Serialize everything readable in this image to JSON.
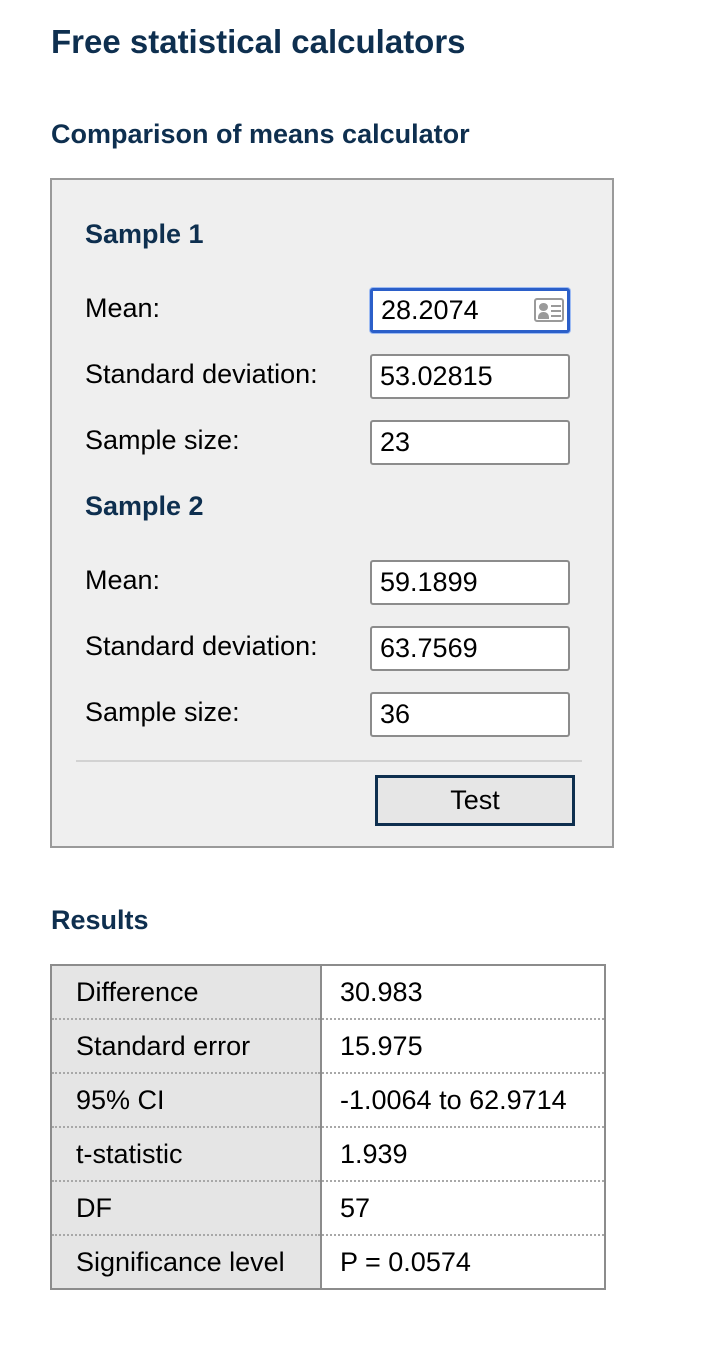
{
  "page_title": "Free statistical calculators",
  "calculator": {
    "title": "Comparison of means calculator",
    "sample1": {
      "heading": "Sample 1",
      "mean_label": "Mean:",
      "mean_value": "28.2074",
      "sd_label": "Standard deviation:",
      "sd_value": "53.02815",
      "size_label": "Sample size:",
      "size_value": "23"
    },
    "sample2": {
      "heading": "Sample 2",
      "mean_label": "Mean:",
      "mean_value": "59.1899",
      "sd_label": "Standard deviation:",
      "sd_value": "63.7569",
      "size_label": "Sample size:",
      "size_value": "36"
    },
    "test_button_label": "Test"
  },
  "results": {
    "title": "Results",
    "rows": [
      {
        "label": "Difference",
        "value": "30.983"
      },
      {
        "label": "Standard error",
        "value": "15.975"
      },
      {
        "label": "95% CI",
        "value": "-1.0064 to 62.9714"
      },
      {
        "label": "t-statistic",
        "value": "1.939"
      },
      {
        "label": "DF",
        "value": "57"
      },
      {
        "label": "Significance level",
        "value": "P = 0.0574"
      }
    ]
  },
  "colors": {
    "heading": "#0e2f4f",
    "panel_background": "#efefef",
    "focus_ring": "#2b5fc9"
  },
  "icons": {
    "autofill": "contact-card-icon"
  }
}
